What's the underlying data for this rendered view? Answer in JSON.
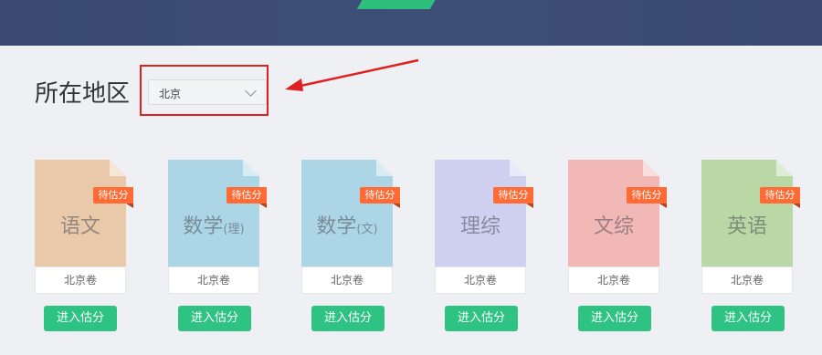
{
  "region": {
    "label": "所在地区",
    "selected": "北京"
  },
  "colors": {
    "accent_green": "#2ec283",
    "tag_orange": "#ff6a35",
    "highlight_red": "#e02020"
  },
  "subjects": [
    {
      "name": "语文",
      "sub": "",
      "tag": "待估分",
      "footer": "北京卷",
      "button": "进入估分",
      "color": "#e9c9a9"
    },
    {
      "name": "数学",
      "sub": "(理)",
      "tag": "待估分",
      "footer": "北京卷",
      "button": "进入估分",
      "color": "#acd6e6"
    },
    {
      "name": "数学",
      "sub": "(文)",
      "tag": "待估分",
      "footer": "北京卷",
      "button": "进入估分",
      "color": "#acd6e6"
    },
    {
      "name": "理综",
      "sub": "",
      "tag": "待估分",
      "footer": "北京卷",
      "button": "进入估分",
      "color": "#cfd0f0"
    },
    {
      "name": "文综",
      "sub": "",
      "tag": "待估分",
      "footer": "北京卷",
      "button": "进入估分",
      "color": "#f2b8b6"
    },
    {
      "name": "英语",
      "sub": "",
      "tag": "待估分",
      "footer": "北京卷",
      "button": "进入估分",
      "color": "#b9d8a5"
    }
  ]
}
